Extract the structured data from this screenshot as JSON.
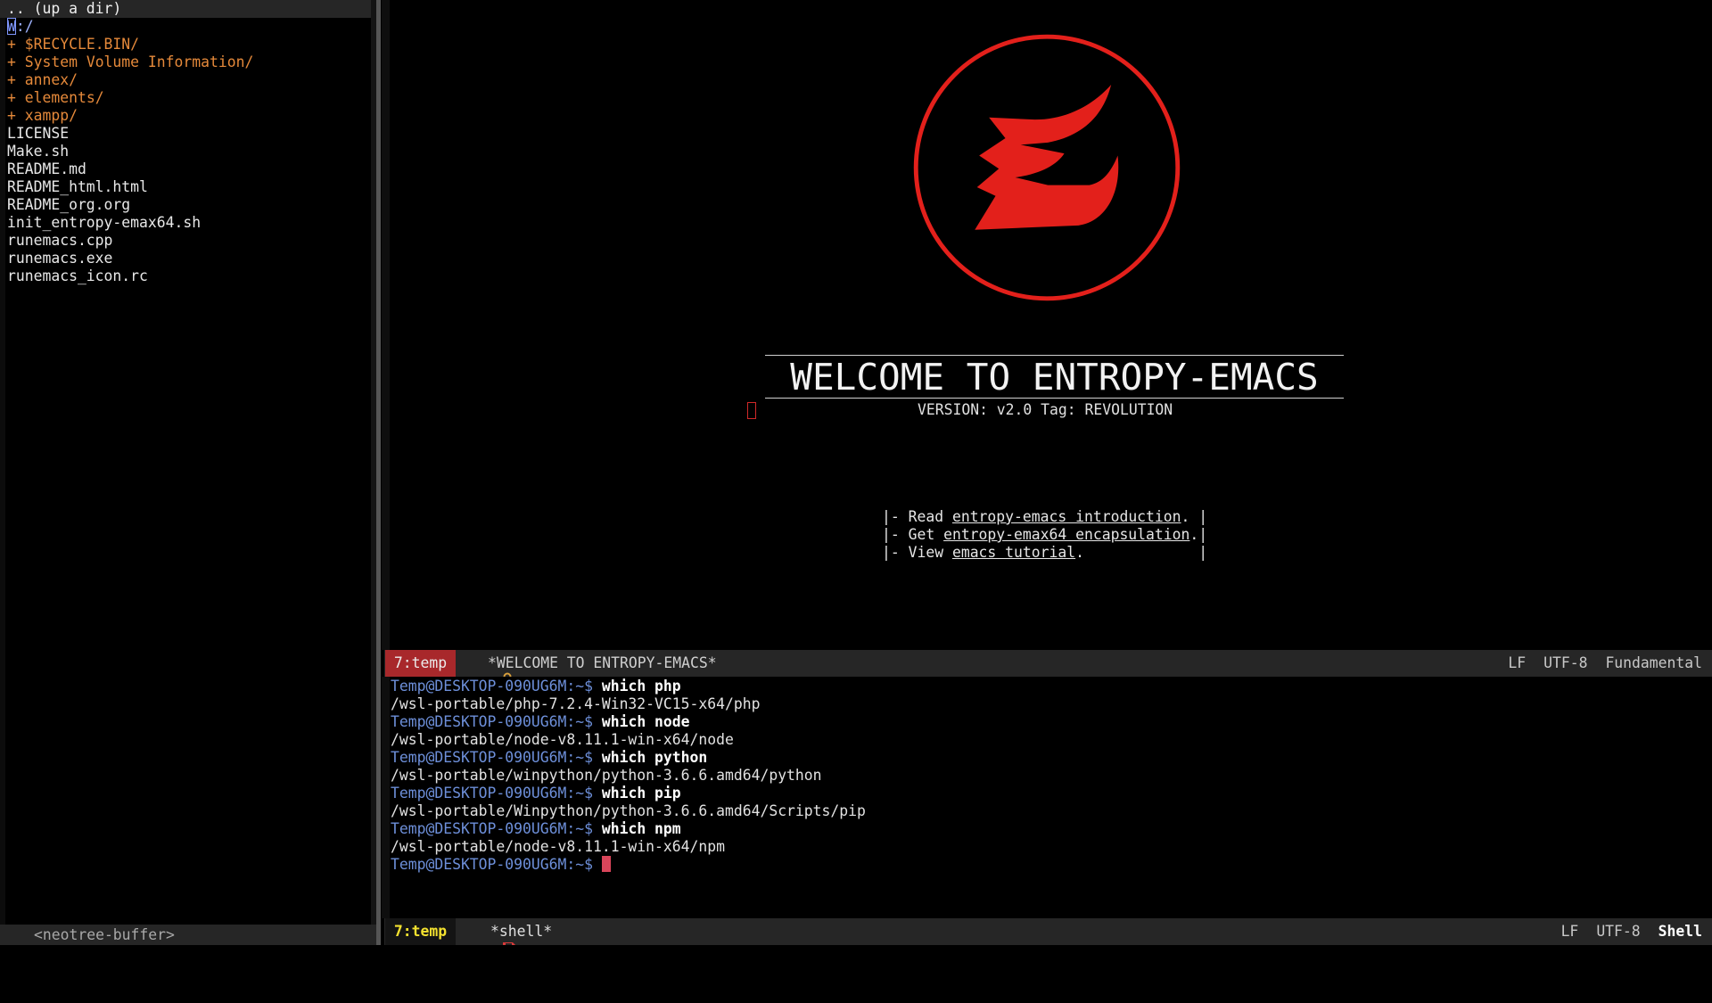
{
  "neotree": {
    "header": ".. (up a dir)",
    "root_cursor": "W",
    "root_rest": ":/",
    "dirs": [
      {
        "toggle": "+",
        "name": "$RECYCLE.BIN/"
      },
      {
        "toggle": "+",
        "name": "System Volume Information/"
      },
      {
        "toggle": "+",
        "name": "annex/"
      },
      {
        "toggle": "+",
        "name": "elements/"
      },
      {
        "toggle": "+",
        "name": "xampp/"
      }
    ],
    "files": [
      "LICENSE",
      "Make.sh",
      "README.md",
      "README_html.html",
      "README_org.org",
      "init_entropy-emax64.sh",
      "runemacs.cpp",
      "runemacs.exe",
      "runemacs_icon.rc"
    ],
    "modeline": {
      "icon": "arrow-right-icon",
      "buffer": "<neotree-buffer>"
    }
  },
  "welcome": {
    "logo_icon": "entropy-emacs-logo",
    "title": "WELCOME TO ENTROPY-EMACS",
    "version": "VERSION: v2.0 Tag: REVOLUTION",
    "links": [
      {
        "prefix": "|- Read ",
        "label": "entropy-emacs introduction",
        "suffix": ". |"
      },
      {
        "prefix": "|- Get ",
        "label": "entropy-emax64 encapsulation",
        "suffix": ".|"
      },
      {
        "prefix": "|- View ",
        "label": "emacs tutorial",
        "suffix": ".             |"
      }
    ]
  },
  "modeline_welcome": {
    "window": "7:temp",
    "lock_icon": "lock-icon",
    "buffer": "*WELCOME TO ENTROPY-EMACS*",
    "eol": "LF",
    "encoding": "UTF-8",
    "mode": "Fundamental"
  },
  "shell": {
    "prompt": "Temp@DESKTOP-090UG6M:~$",
    "history": [
      {
        "command": "which php",
        "output": "/wsl-portable/php-7.2.4-Win32-VC15-x64/php"
      },
      {
        "command": "which node",
        "output": "/wsl-portable/node-v8.11.1-win-x64/node"
      },
      {
        "command": "which python",
        "output": "/wsl-portable/winpython/python-3.6.6.amd64/python"
      },
      {
        "command": "which pip",
        "output": "/wsl-portable/Winpython/python-3.6.6.amd64/Scripts/pip"
      },
      {
        "command": "which npm",
        "output": "/wsl-portable/node-v8.11.1-win-x64/npm"
      }
    ]
  },
  "modeline_shell": {
    "window": "7:temp",
    "save_icon": "floppy-disk-icon",
    "buffer": "*shell*",
    "eol": "LF",
    "encoding": "UTF-8",
    "mode": "Shell"
  },
  "colors": {
    "logo_red": "#e3201b",
    "directory_orange": "#e5893a",
    "prompt_blue": "#6d8fd9",
    "window_badge_red": "#a8282b",
    "window_badge_yellow": "#f3e12f",
    "cursor": "#d9455a"
  }
}
